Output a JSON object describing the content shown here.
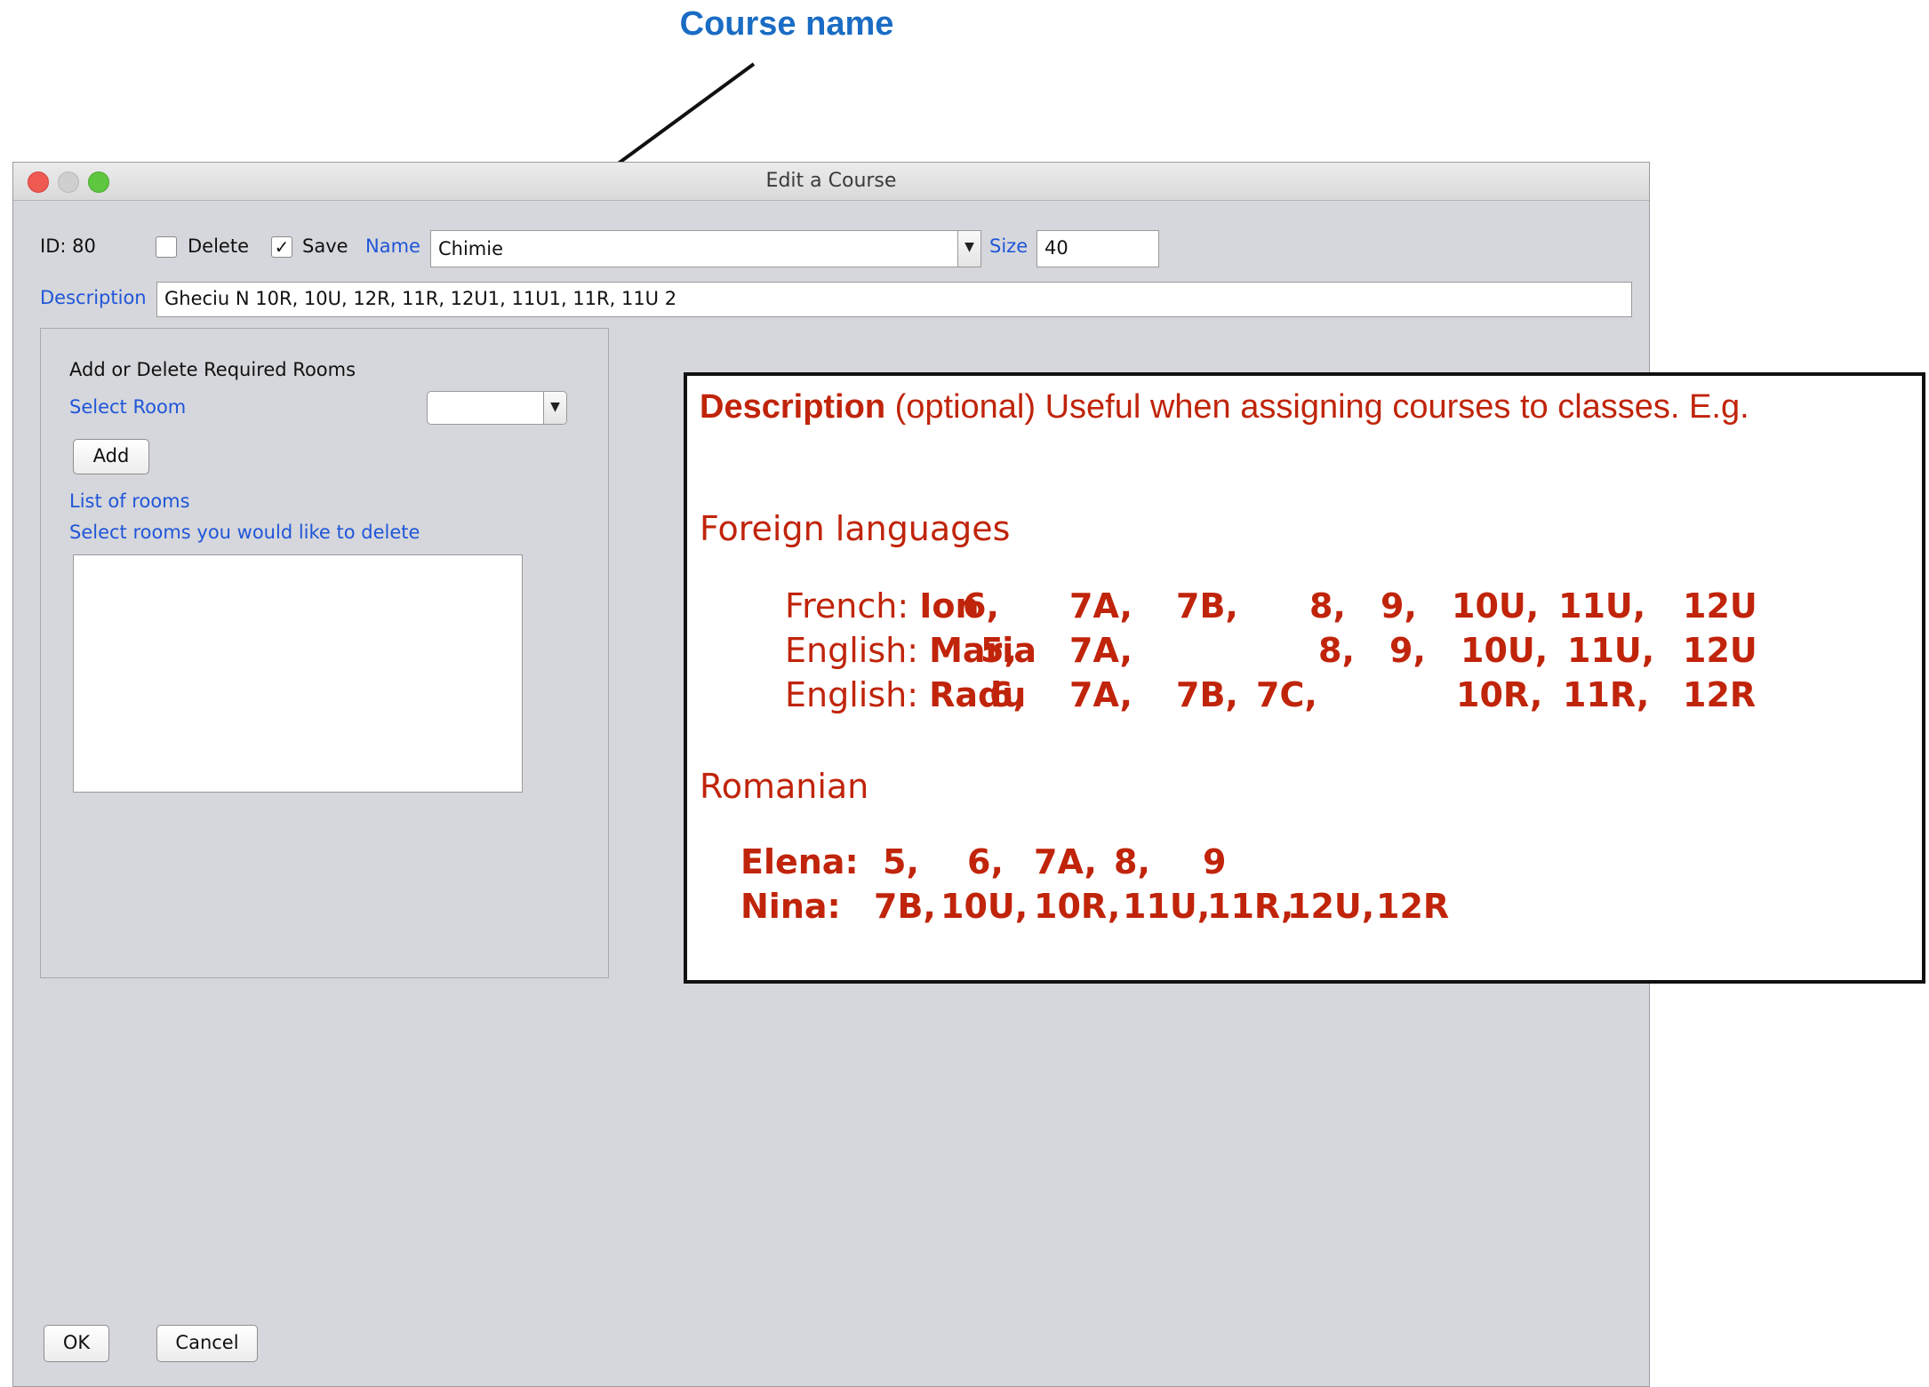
{
  "annotation": {
    "course_name_label": "Course name"
  },
  "window": {
    "title": "Edit a Course"
  },
  "form": {
    "id_label": "ID: 80",
    "delete_label": "Delete",
    "save_label": "Save",
    "save_checked": true,
    "name_label": "Name",
    "name_value": "Chimie",
    "size_label": "Size",
    "size_value": "40",
    "description_label": "Description",
    "description_value": "Gheciu N 10R, 10U, 12R, 11R, 12U1, 11U1, 11R, 11U 2"
  },
  "rooms_panel": {
    "heading": "Add or Delete Required Rooms",
    "select_room_label": "Select Room",
    "select_room_value": "",
    "add_button": "Add",
    "list_label": "List of rooms",
    "delete_hint": "Select rooms you would like to delete",
    "rooms": []
  },
  "buttons": {
    "ok": "OK",
    "cancel": "Cancel"
  },
  "callout": {
    "title_bold": "Description",
    "title_rest": " (optional) Useful when assigning courses to classes. E.g.",
    "section1": "Foreign languages",
    "foreign_rows": [
      {
        "prefix": "French: ",
        "name": "Ion",
        "classes": [
          "6,",
          "7A,",
          "7B,",
          "8,",
          "9,",
          "10U,",
          "11U,",
          "12U"
        ]
      },
      {
        "prefix": "English: ",
        "name": "Maria",
        "classes": [
          "5,",
          "7A,",
          "8,",
          "9,",
          "10U,",
          "11U,",
          "12U"
        ]
      },
      {
        "prefix": "English: ",
        "name": "Radu",
        "classes": [
          "6,",
          "7A,",
          "7B,",
          "7C,",
          "10R,",
          "11R,",
          "12R"
        ]
      }
    ],
    "section2": "Romanian",
    "romanian_rows": [
      {
        "name": "Elena:",
        "classes": [
          "5,",
          "6,",
          "7A,",
          "8,",
          "9"
        ]
      },
      {
        "name": "Nina:",
        "classes": [
          "7B,",
          "10U,",
          "10R,",
          "11U,",
          "11R,",
          "12U,",
          "12R"
        ]
      }
    ]
  },
  "colors": {
    "accent_blue": "#1f56d8",
    "annotation_blue": "#1a6cc4",
    "callout_red": "#c0240a"
  }
}
